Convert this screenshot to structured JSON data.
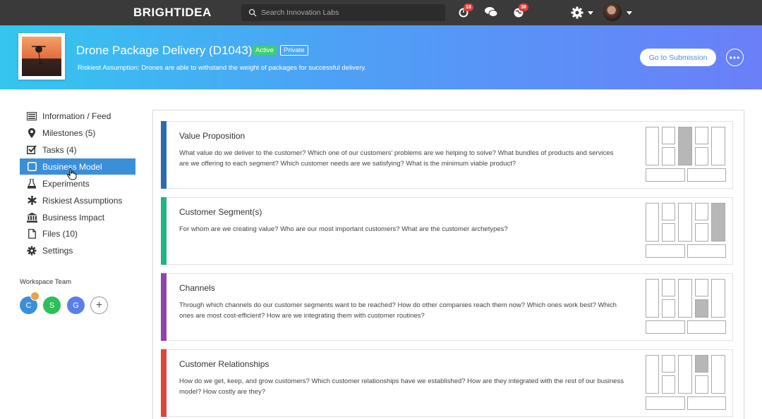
{
  "topbar": {
    "logo": "BRIGHTIDEA",
    "search_placeholder": "Search Innovation Labs",
    "notifications": [
      {
        "icon": "stopwatch-icon",
        "count": "18"
      },
      {
        "icon": "chat-bubbles-icon",
        "count": ""
      },
      {
        "icon": "globe-icon",
        "count": "38"
      }
    ],
    "settings_icon": "gear-icon"
  },
  "header": {
    "title": "Drone Package Delivery (D1043)",
    "status": "Active",
    "visibility": "Private",
    "subtitle": "Riskiest Assumption: Drones are able to withstand the weight of packages for successful delivery.",
    "goto_label": "Go to Submission",
    "more_icon": "ellipsis-icon"
  },
  "sidebar": {
    "items": [
      {
        "label": "Information / Feed",
        "icon": "feed-icon",
        "active": false
      },
      {
        "label": "Milestones (5)",
        "icon": "map-pin-icon",
        "active": false
      },
      {
        "label": "Tasks (4)",
        "icon": "checkbox-icon",
        "active": false
      },
      {
        "label": "Business Model",
        "icon": "square-icon",
        "active": true
      },
      {
        "label": "Experiments",
        "icon": "flask-icon",
        "active": false
      },
      {
        "label": "Riskiest Assumptions",
        "icon": "asterisk-icon",
        "active": false
      },
      {
        "label": "Business Impact",
        "icon": "bank-icon",
        "active": false
      },
      {
        "label": "Files (10)",
        "icon": "file-icon",
        "active": false
      },
      {
        "label": "Settings",
        "icon": "gear-icon",
        "active": false
      }
    ],
    "team_label": "Workspace Team",
    "team": [
      {
        "initial": "C",
        "color": "#3a8fd8"
      },
      {
        "initial": "S",
        "color": "#2dbf5a"
      },
      {
        "initial": "G",
        "color": "#5b7fe6"
      }
    ]
  },
  "cards": [
    {
      "title": "Value Proposition",
      "color": "#2b6cb0",
      "text": "What value do we deliver to the customer? Which one of our customers’ problems are we helping to solve? What bundles of products and services are we offering to each segment? Which customer needs are we satisfying? What is the minimum viable product?"
    },
    {
      "title": "Customer Segment(s)",
      "color": "#1fb386",
      "text": "For whom are we creating value? Who are our most important customers? What are the customer archetypes?"
    },
    {
      "title": "Channels",
      "color": "#8e44ad",
      "text": "Through which channels do our customer segments want to be reached? How do other companies reach them now? Which ones work best? Which ones are most cost-efficient? How are we integrating them with customer routines?"
    },
    {
      "title": "Customer Relationships",
      "color": "#d9483b",
      "text": "How do we get, keep, and grow customers? Which customer relationships have we established? How are they integrated with the rest of our business model? How costly are they?"
    }
  ]
}
